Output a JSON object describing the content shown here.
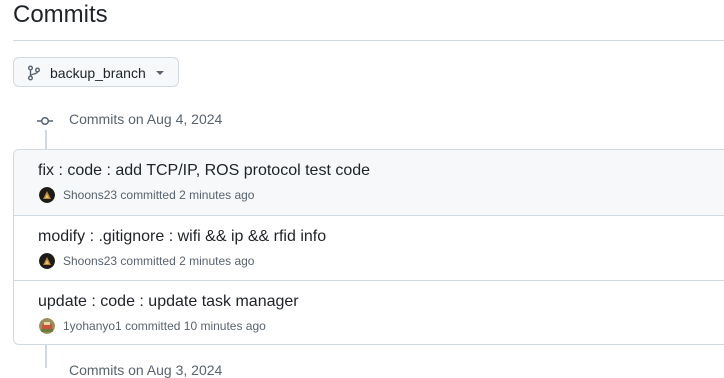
{
  "page": {
    "title": "Commits"
  },
  "branch": {
    "name": "backup_branch",
    "icon": "git-branch-icon",
    "dropdown_icon": "triangle-down-icon"
  },
  "groups": [
    {
      "heading": "Commits on Aug 4, 2024",
      "commits": [
        {
          "title": "fix : code : add TCP/IP, ROS protocol test code",
          "author": "Shoons23",
          "verb": "committed",
          "time": "2 minutes ago",
          "avatar": "avatar-shoons23"
        },
        {
          "title": "modify : .gitignore : wifi && ip && rfid info",
          "author": "Shoons23",
          "verb": "committed",
          "time": "2 minutes ago",
          "avatar": "avatar-shoons23"
        },
        {
          "title": "update : code : update task manager",
          "author": "1yohanyo1",
          "verb": "committed",
          "time": "10 minutes ago",
          "avatar": "avatar-1yohanyo1"
        }
      ]
    },
    {
      "heading": "Commits on Aug 3, 2024"
    }
  ],
  "colors": {
    "border": "#d1d9e0",
    "muted": "#59636e",
    "text": "#1f2328",
    "highlight_row": "#f6f8fa"
  }
}
